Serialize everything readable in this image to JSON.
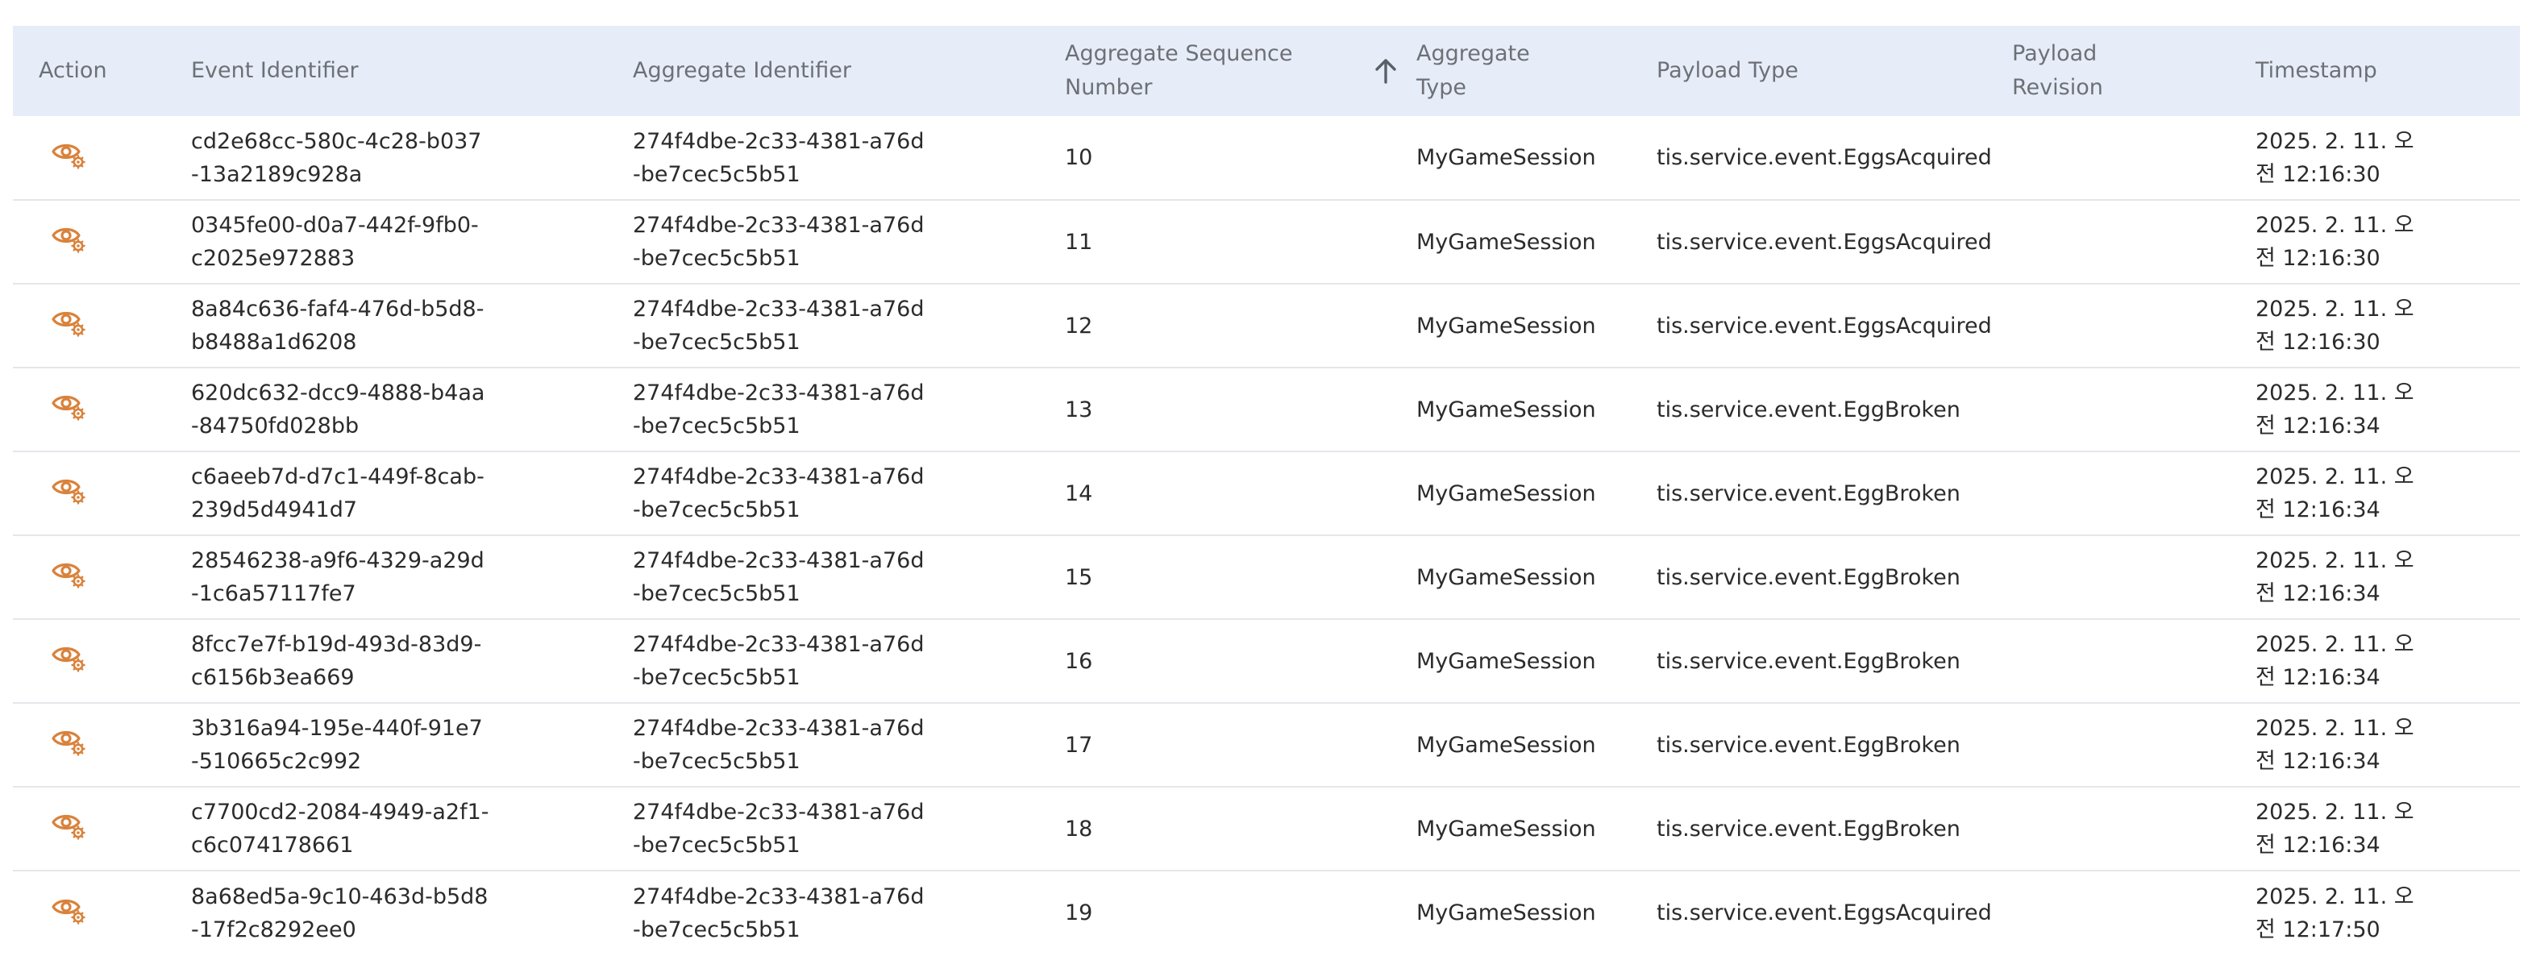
{
  "table": {
    "headers": {
      "action": "Action",
      "event_id": "Event Identifier",
      "aggregate_id": "Aggregate Identifier",
      "sequence": "Aggregate Sequence Number",
      "aggregate_type": "Aggregate Type",
      "payload_type": "Payload Type",
      "payload_revision": "Payload Revision",
      "timestamp": "Timestamp"
    },
    "sort": {
      "column": "sequence",
      "direction": "ascending"
    },
    "action_icon": "eye-gear-icon",
    "accent_color": "#d9823b",
    "header_bg": "#e6edf9",
    "rows": [
      {
        "event_id": "cd2e68cc-580c-4c28-b037-13a2189c928a",
        "aggregate_id": "274f4dbe-2c33-4381-a76d-be7cec5c5b51",
        "sequence": "10",
        "aggregate_type": "MyGameSession",
        "payload_type": "tis.service.event.EggsAcquired",
        "payload_revision": "",
        "timestamp": "2025. 2. 11. 오전 12:16:30"
      },
      {
        "event_id": "0345fe00-d0a7-442f-9fb0-c2025e972883",
        "aggregate_id": "274f4dbe-2c33-4381-a76d-be7cec5c5b51",
        "sequence": "11",
        "aggregate_type": "MyGameSession",
        "payload_type": "tis.service.event.EggsAcquired",
        "payload_revision": "",
        "timestamp": "2025. 2. 11. 오전 12:16:30"
      },
      {
        "event_id": "8a84c636-faf4-476d-b5d8-b8488a1d6208",
        "aggregate_id": "274f4dbe-2c33-4381-a76d-be7cec5c5b51",
        "sequence": "12",
        "aggregate_type": "MyGameSession",
        "payload_type": "tis.service.event.EggsAcquired",
        "payload_revision": "",
        "timestamp": "2025. 2. 11. 오전 12:16:30"
      },
      {
        "event_id": "620dc632-dcc9-4888-b4aa-84750fd028bb",
        "aggregate_id": "274f4dbe-2c33-4381-a76d-be7cec5c5b51",
        "sequence": "13",
        "aggregate_type": "MyGameSession",
        "payload_type": "tis.service.event.EggBroken",
        "payload_revision": "",
        "timestamp": "2025. 2. 11. 오전 12:16:34"
      },
      {
        "event_id": "c6aeeb7d-d7c1-449f-8cab-239d5d4941d7",
        "aggregate_id": "274f4dbe-2c33-4381-a76d-be7cec5c5b51",
        "sequence": "14",
        "aggregate_type": "MyGameSession",
        "payload_type": "tis.service.event.EggBroken",
        "payload_revision": "",
        "timestamp": "2025. 2. 11. 오전 12:16:34"
      },
      {
        "event_id": "28546238-a9f6-4329-a29d-1c6a57117fe7",
        "aggregate_id": "274f4dbe-2c33-4381-a76d-be7cec5c5b51",
        "sequence": "15",
        "aggregate_type": "MyGameSession",
        "payload_type": "tis.service.event.EggBroken",
        "payload_revision": "",
        "timestamp": "2025. 2. 11. 오전 12:16:34"
      },
      {
        "event_id": "8fcc7e7f-b19d-493d-83d9-c6156b3ea669",
        "aggregate_id": "274f4dbe-2c33-4381-a76d-be7cec5c5b51",
        "sequence": "16",
        "aggregate_type": "MyGameSession",
        "payload_type": "tis.service.event.EggBroken",
        "payload_revision": "",
        "timestamp": "2025. 2. 11. 오전 12:16:34"
      },
      {
        "event_id": "3b316a94-195e-440f-91e7-510665c2c992",
        "aggregate_id": "274f4dbe-2c33-4381-a76d-be7cec5c5b51",
        "sequence": "17",
        "aggregate_type": "MyGameSession",
        "payload_type": "tis.service.event.EggBroken",
        "payload_revision": "",
        "timestamp": "2025. 2. 11. 오전 12:16:34"
      },
      {
        "event_id": "c7700cd2-2084-4949-a2f1-c6c074178661",
        "aggregate_id": "274f4dbe-2c33-4381-a76d-be7cec5c5b51",
        "sequence": "18",
        "aggregate_type": "MyGameSession",
        "payload_type": "tis.service.event.EggBroken",
        "payload_revision": "",
        "timestamp": "2025. 2. 11. 오전 12:16:34"
      },
      {
        "event_id": "8a68ed5a-9c10-463d-b5d8-17f2c8292ee0",
        "aggregate_id": "274f4dbe-2c33-4381-a76d-be7cec5c5b51",
        "sequence": "19",
        "aggregate_type": "MyGameSession",
        "payload_type": "tis.service.event.EggsAcquired",
        "payload_revision": "",
        "timestamp": "2025. 2. 11. 오전 12:17:50"
      }
    ]
  }
}
